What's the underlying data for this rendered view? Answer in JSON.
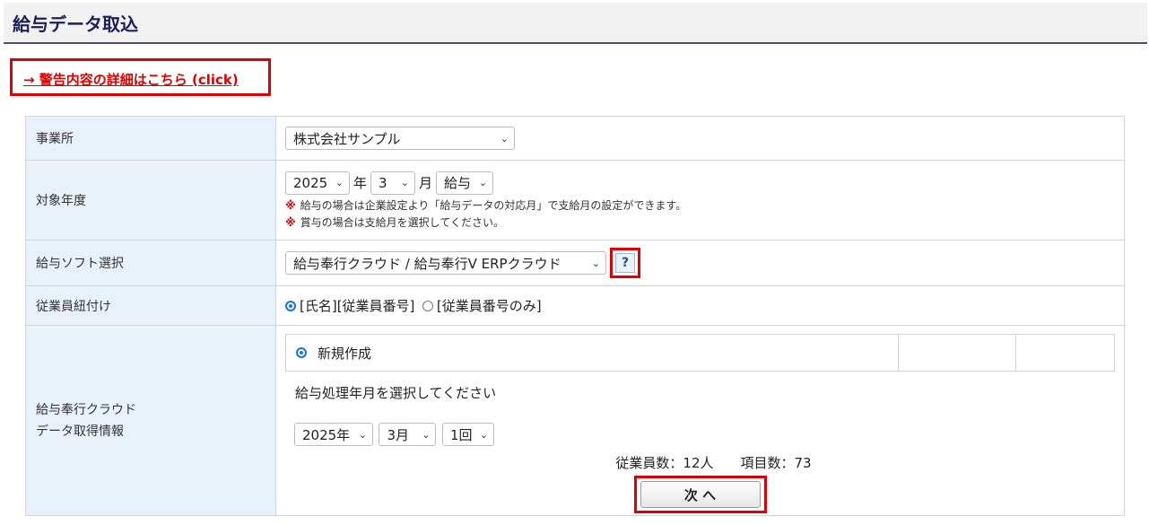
{
  "header": {
    "title": "給与データ取込"
  },
  "warning_link": "→ 警告内容の詳細はこちら (click)",
  "rows": {
    "office": {
      "label": "事業所",
      "selected": "株式会社サンプル"
    },
    "target_year": {
      "label": "対象年度",
      "year": "2025",
      "year_unit": "年",
      "month": "3",
      "month_unit": "月",
      "type": "給与",
      "notes": [
        "給与の場合は企業設定より「給与データの対応月」で支給月の設定ができます。",
        "賞与の場合は支給月を選択してください。"
      ],
      "note_mark": "※"
    },
    "software": {
      "label": "給与ソフト選択",
      "selected": "給与奉行クラウド / 給与奉行V ERPクラウド",
      "help": "?"
    },
    "link_employee": {
      "label": "従業員紐付け",
      "option1": "[氏名][従業員番号]",
      "option2": "[従業員番号のみ]",
      "selected_option": 1
    },
    "bugyo": {
      "label_line1": "給与奉行クラウド",
      "label_line2": "データ取得情報",
      "new_create": "新規作成",
      "prompt": "給与処理年月を選択してください",
      "year_sel": "2025年",
      "month_sel": "3月",
      "count_sel": "1回",
      "summary": "従業員数：12人　　項目数：73",
      "next_button": "次 へ"
    }
  },
  "colors": {
    "accent_red": "#e00000",
    "label_bg": "#e8f2fb",
    "title_navy": "#1a1f57"
  }
}
